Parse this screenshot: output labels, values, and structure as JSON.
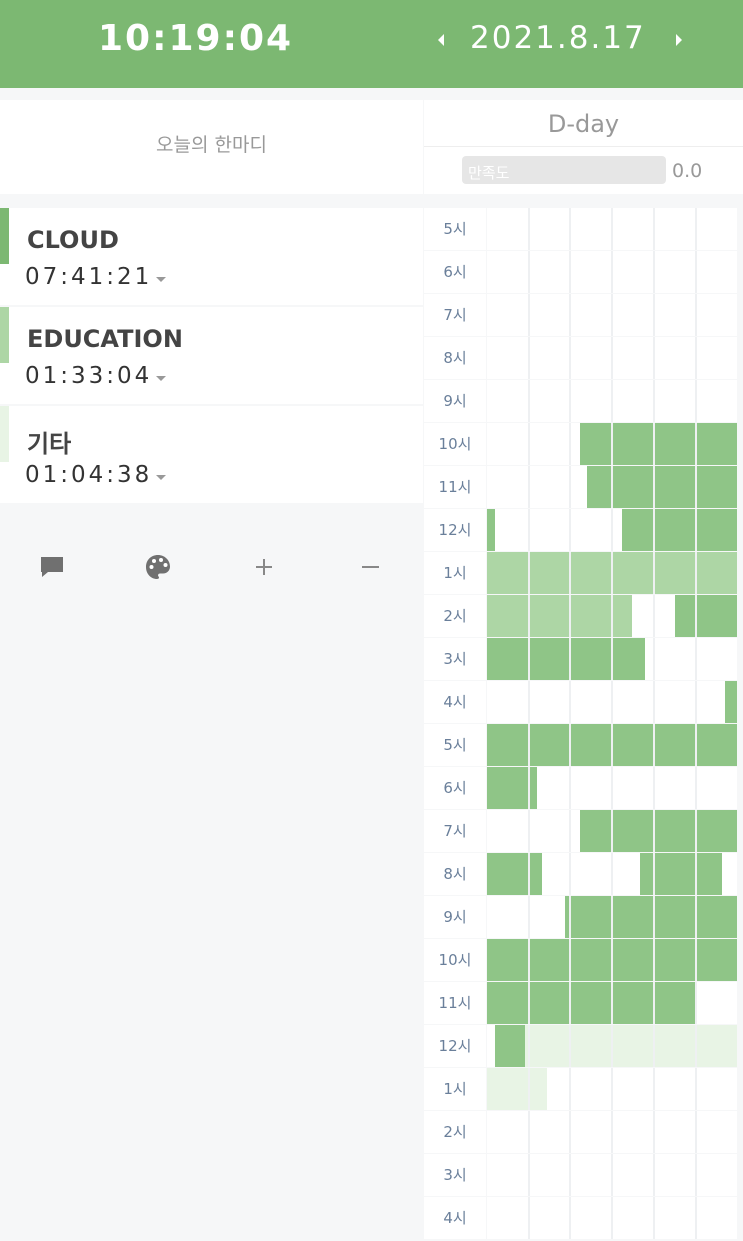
{
  "header": {
    "clock": "10:19:04",
    "date": "2021.8.17",
    "prev_icon": "caret-left-icon",
    "next_icon": "caret-right-icon",
    "background_color": "#7cb872"
  },
  "motto": {
    "placeholder": "오늘의 한마디"
  },
  "dday": {
    "title": "D-day",
    "satisfaction_label": "만족도",
    "satisfaction_value": "0.0"
  },
  "subjects": [
    {
      "name": "CLOUD",
      "time": "07:41:21",
      "color": "#7cb872"
    },
    {
      "name": "EDUCATION",
      "time": "01:33:04",
      "color": "#add6a5"
    },
    {
      "name": "기타",
      "time": "01:04:38",
      "color": "#e8f4e5"
    }
  ],
  "toolbar": [
    {
      "icon": "comment-icon"
    },
    {
      "icon": "palette-icon"
    },
    {
      "icon": "plus-icon"
    },
    {
      "icon": "minus-icon"
    }
  ],
  "timetable": {
    "hours": [
      "5시",
      "6시",
      "7시",
      "8시",
      "9시",
      "10시",
      "11시",
      "12시",
      "1시",
      "2시",
      "3시",
      "4시",
      "5시",
      "6시",
      "7시",
      "8시",
      "9시",
      "10시",
      "11시",
      "12시",
      "1시",
      "2시",
      "3시",
      "4시"
    ],
    "blocks": [
      {
        "hour": 5,
        "segments": [
          [
            0.37,
            1.0,
            0
          ]
        ]
      },
      {
        "hour": 6,
        "segments": [
          [
            0.4,
            1.0,
            0
          ]
        ]
      },
      {
        "hour": 7,
        "segments": [
          [
            0.0,
            0.03,
            0
          ],
          [
            0.54,
            1.0,
            0
          ]
        ]
      },
      {
        "hour": 8,
        "segments": [
          [
            0.0,
            1.0,
            1
          ]
        ]
      },
      {
        "hour": 9,
        "segments": [
          [
            0.0,
            0.58,
            1
          ],
          [
            0.75,
            1.0,
            0
          ]
        ]
      },
      {
        "hour": 10,
        "segments": [
          [
            0.0,
            0.63,
            0
          ]
        ]
      },
      {
        "hour": 11,
        "segments": [
          [
            0.95,
            1.0,
            0
          ]
        ]
      },
      {
        "hour": 12,
        "segments": [
          [
            0.0,
            1.0,
            0
          ]
        ]
      },
      {
        "hour": 13,
        "segments": [
          [
            0.0,
            0.2,
            0
          ]
        ]
      },
      {
        "hour": 14,
        "segments": [
          [
            0.37,
            1.0,
            0
          ]
        ]
      },
      {
        "hour": 15,
        "segments": [
          [
            0.0,
            0.22,
            0
          ],
          [
            0.61,
            0.94,
            0
          ]
        ]
      },
      {
        "hour": 16,
        "segments": [
          [
            0.31,
            1.0,
            0
          ]
        ]
      },
      {
        "hour": 17,
        "segments": [
          [
            0.0,
            1.0,
            0
          ]
        ]
      },
      {
        "hour": 18,
        "segments": [
          [
            0.0,
            0.84,
            0
          ]
        ]
      },
      {
        "hour": 19,
        "segments": [
          [
            0.03,
            0.15,
            0
          ],
          [
            0.15,
            1.0,
            2
          ]
        ]
      },
      {
        "hour": 20,
        "segments": [
          [
            0.0,
            0.24,
            2
          ]
        ]
      }
    ]
  }
}
